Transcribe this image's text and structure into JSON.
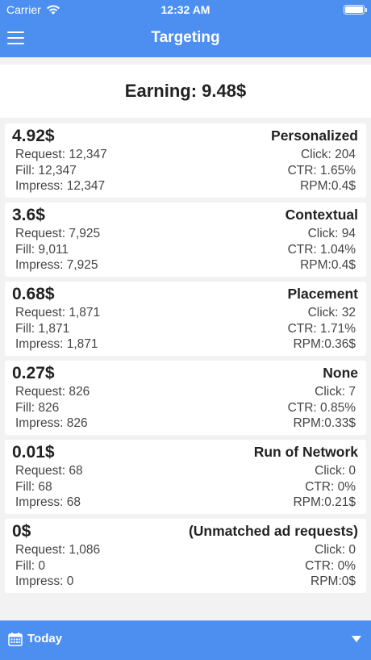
{
  "status": {
    "carrier": "Carrier",
    "time": "12:32 AM"
  },
  "header": {
    "title": "Targeting"
  },
  "summary": {
    "earning": "Earning: 9.48$"
  },
  "rows": [
    {
      "amount": "4.92$",
      "name": "Personalized",
      "request": "Request: 12,347",
      "fill": "Fill: 12,347",
      "impress": "Impress: 12,347",
      "click": "Click: 204",
      "ctr": "CTR: 1.65%",
      "rpm": "RPM:0.4$"
    },
    {
      "amount": "3.6$",
      "name": "Contextual",
      "request": "Request: 7,925",
      "fill": "Fill: 9,011",
      "impress": "Impress: 7,925",
      "click": "Click: 94",
      "ctr": "CTR: 1.04%",
      "rpm": "RPM:0.4$"
    },
    {
      "amount": "0.68$",
      "name": "Placement",
      "request": "Request: 1,871",
      "fill": "Fill: 1,871",
      "impress": "Impress: 1,871",
      "click": "Click: 32",
      "ctr": "CTR: 1.71%",
      "rpm": "RPM:0.36$"
    },
    {
      "amount": "0.27$",
      "name": "None",
      "request": "Request: 826",
      "fill": "Fill: 826",
      "impress": "Impress: 826",
      "click": "Click: 7",
      "ctr": "CTR: 0.85%",
      "rpm": "RPM:0.33$"
    },
    {
      "amount": "0.01$",
      "name": "Run of Network",
      "request": "Request: 68",
      "fill": "Fill: 68",
      "impress": "Impress: 68",
      "click": "Click: 0",
      "ctr": "CTR: 0%",
      "rpm": "RPM:0.21$"
    },
    {
      "amount": "0$",
      "name": "(Unmatched ad requests)",
      "request": "Request: 1,086",
      "fill": "Fill: 0",
      "impress": "Impress: 0",
      "click": "Click: 0",
      "ctr": "CTR: 0%",
      "rpm": "RPM:0$"
    }
  ],
  "footer": {
    "period": "Today"
  },
  "icons": {
    "menu": "hamburger-menu-icon",
    "calendar": "calendar-icon",
    "dropdown": "chevron-down-icon",
    "wifi": "wifi-icon",
    "battery": "battery-icon"
  },
  "colors": {
    "accent": "#4c8ff1",
    "background": "#f2f2f2",
    "card": "#ffffff"
  }
}
